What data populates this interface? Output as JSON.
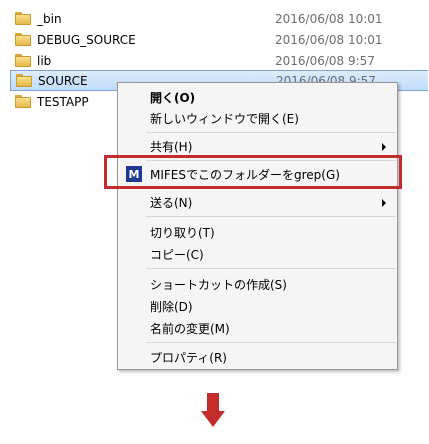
{
  "files": [
    {
      "name": "_bin",
      "date": "2016/06/08 10:01"
    },
    {
      "name": "DEBUG_SOURCE",
      "date": "2016/06/08 10:01"
    },
    {
      "name": "lib",
      "date": "2016/06/08 9:57"
    },
    {
      "name": "SOURCE",
      "date": "2016/06/08 9:57"
    },
    {
      "name": "TESTAPP",
      "date": ""
    }
  ],
  "menu": {
    "open": "開く(O)",
    "open_new_window": "新しいウィンドウで開く(E)",
    "share": "共有(H)",
    "mifes_grep": "MIFESでこのフォルダーをgrep(G)",
    "mifes_icon_letter": "M",
    "send_to": "送る(N)",
    "cut": "切り取り(T)",
    "copy": "コピー(C)",
    "create_shortcut": "ショートカットの作成(S)",
    "delete": "削除(D)",
    "rename": "名前の変更(M)",
    "properties": "プロパティ(R)"
  },
  "colors": {
    "highlight_border": "#c42b2b",
    "arrow": "#c42b2b",
    "selection": "#c1dcfc"
  }
}
